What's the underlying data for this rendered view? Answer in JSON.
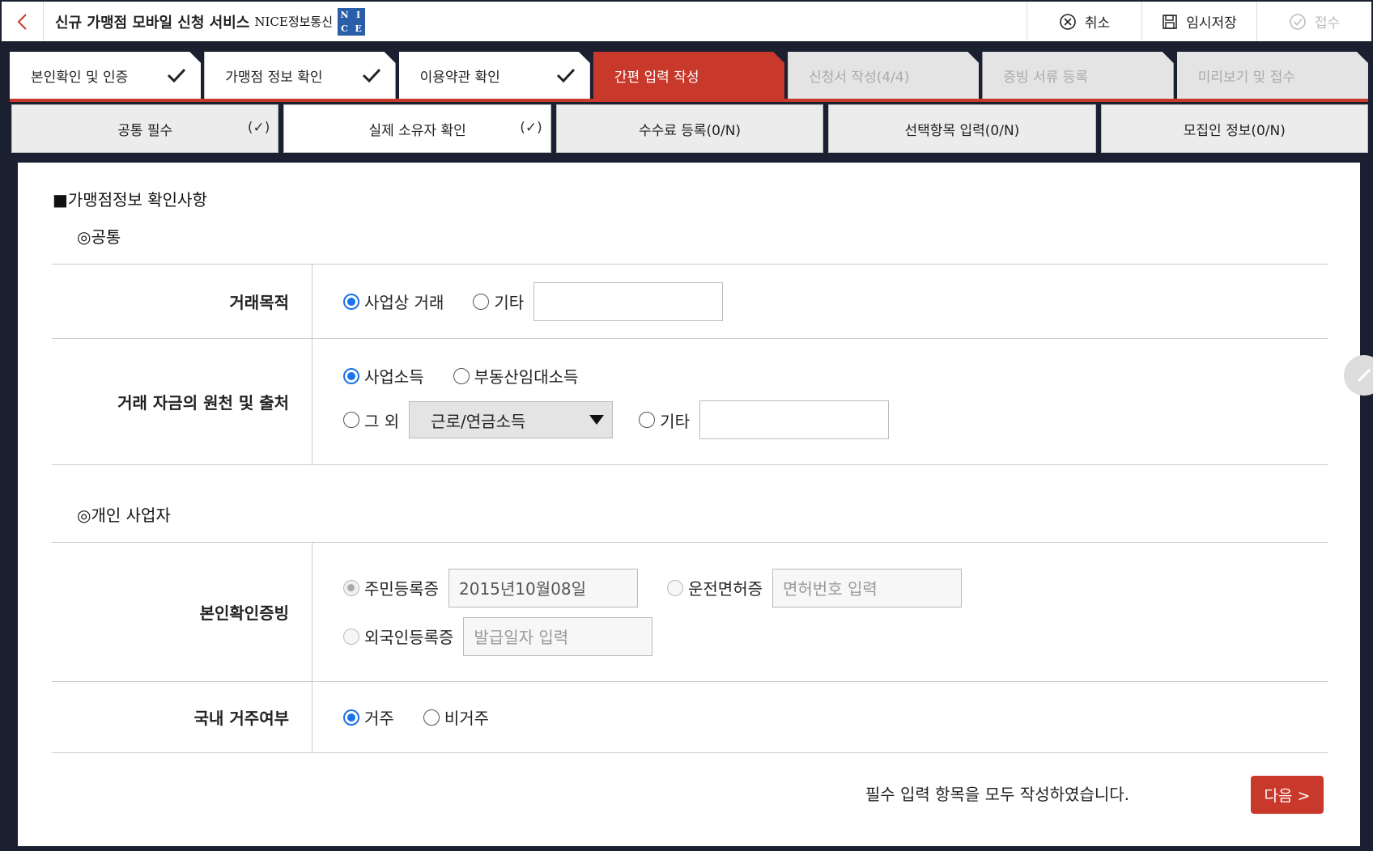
{
  "header": {
    "title": "신규 가맹점 모바일 신청 서비스",
    "brand": "NICE정보통신",
    "logo_letters": [
      "N",
      "I",
      "C",
      "E"
    ],
    "actions": [
      {
        "label": "취소"
      },
      {
        "label": "임시저장"
      },
      {
        "label": "접수"
      }
    ]
  },
  "steps": [
    {
      "label": "본인확인 및 인증"
    },
    {
      "label": "가맹점 정보 확인"
    },
    {
      "label": "이용약관 확인"
    },
    {
      "label": "간편 입력 작성"
    },
    {
      "label": "신청서 작성(4/4)"
    },
    {
      "label": "증빙 서류 등록"
    },
    {
      "label": "미리보기 및 접수"
    }
  ],
  "subtabs": [
    {
      "label": "공통 필수",
      "mark": "(✓)"
    },
    {
      "label": "실제 소유자 확인",
      "mark": "(✓)"
    },
    {
      "label": "수수료 등록(0/N)"
    },
    {
      "label": "선택항목 입력(0/N)"
    },
    {
      "label": "모집인 정보(0/N)"
    }
  ],
  "form": {
    "section_title": "■가맹점정보 확인사항",
    "group_common": "◎공통",
    "group_individual": "◎개인 사업자",
    "purpose": {
      "label": "거래목적",
      "opt_business": "사업상 거래",
      "opt_other": "기타",
      "other_value": ""
    },
    "source": {
      "label": "거래 자금의 원천 및 출처",
      "opt_business_income": "사업소득",
      "opt_real_estate": "부동산임대소득",
      "opt_else": "그 외",
      "select_value": "근로/연금소득",
      "opt_other": "기타",
      "other_value": ""
    },
    "id_proof": {
      "label": "본인확인증빙",
      "opt_resident": "주민등록증",
      "resident_value": "2015년10월08일",
      "opt_license": "운전면허증",
      "license_placeholder": "면허번호 입력",
      "opt_foreigner": "외국인등록증",
      "foreigner_placeholder": "발급일자 입력"
    },
    "residence": {
      "label": "국내 거주여부",
      "opt_resident": "거주",
      "opt_nonresident": "비거주"
    }
  },
  "footer": {
    "note": "필수 입력 항목을 모두 작성하였습니다.",
    "next": "다음 >"
  }
}
